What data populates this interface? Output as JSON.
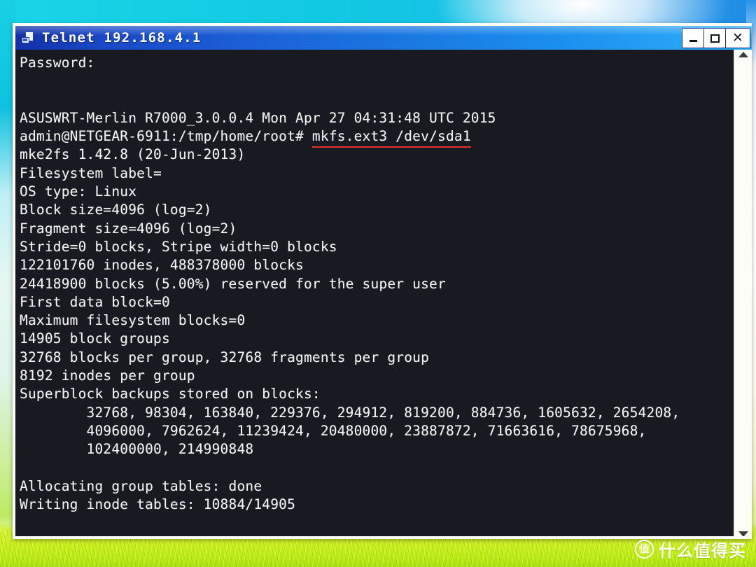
{
  "window": {
    "title": "Telnet  192.168.4.1",
    "icon": "telnet-computer-icon",
    "buttons": {
      "minimize": "_",
      "maximize": "□",
      "close": "✕"
    }
  },
  "terminal": {
    "prompt_line": {
      "prefix": "admin@NETGEAR-6911:/tmp/home/root# ",
      "command": "mkfs.ext3 /dev/sda1",
      "underline_color": "#e8322c"
    },
    "lines": [
      "Password:",
      "",
      "",
      "ASUSWRT-Merlin R7000_3.0.0.4 Mon Apr 27 04:31:48 UTC 2015",
      "__PROMPT__",
      "mke2fs 1.42.8 (20-Jun-2013)",
      "Filesystem label=",
      "OS type: Linux",
      "Block size=4096 (log=2)",
      "Fragment size=4096 (log=2)",
      "Stride=0 blocks, Stripe width=0 blocks",
      "122101760 inodes, 488378000 blocks",
      "24418900 blocks (5.00%) reserved for the super user",
      "First data block=0",
      "Maximum filesystem blocks=0",
      "14905 block groups",
      "32768 blocks per group, 32768 fragments per group",
      "8192 inodes per group",
      "Superblock backups stored on blocks:",
      "        32768, 98304, 163840, 229376, 294912, 819200, 884736, 1605632, 2654208,",
      "        4096000, 7962624, 11239424, 20480000, 23887872, 71663616, 78675968,",
      "        102400000, 214990848",
      "",
      "Allocating group tables: done",
      "Writing inode tables: 10884/14905"
    ],
    "background_color": "#191922",
    "foreground_color": "#f3f3f3"
  },
  "scrollbar": {
    "up_arrow": "scroll-up-arrow",
    "down_arrow": "scroll-down-arrow"
  },
  "watermark": {
    "badge": "值",
    "text": "什么值得买"
  }
}
